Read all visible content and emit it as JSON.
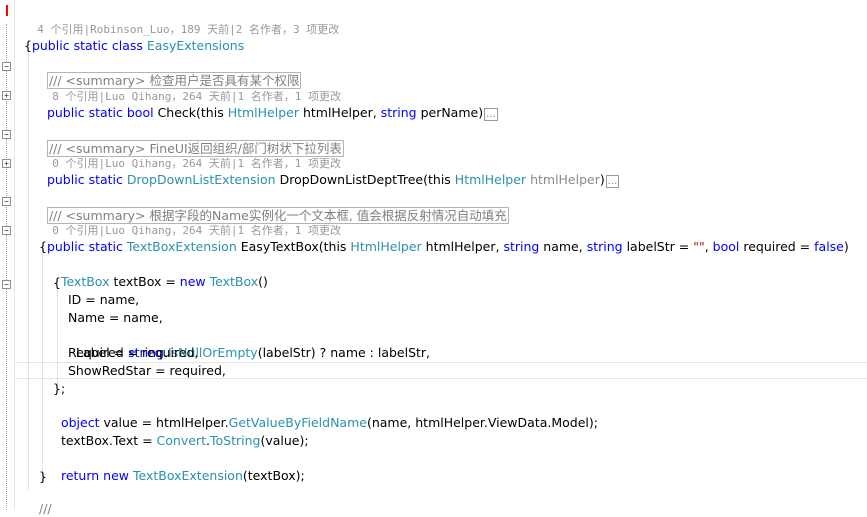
{
  "class_lens": {
    "refs": "4 个引用",
    "sep": "|",
    "author": "Robinson_Luo",
    "age": "，189 天前",
    "authors": "|2 名作者",
    "changes": "，3 项更改"
  },
  "class_decl": {
    "k1": "public",
    "k2": "static",
    "k3": "class",
    "name": "EasyExtensions"
  },
  "brace_open": "{",
  "m1": {
    "summary_prefix": "/// <summary>",
    "summary_text": " 检查用户是否具有某个权限",
    "lens": {
      "refs": "8 个引用",
      "sep": "|",
      "author": "Luo Qihang",
      "age": "，264 天前",
      "authors": "|1 名作者",
      "changes": "，1 项更改"
    },
    "k1": "public",
    "k2": "static",
    "k3": "bool",
    "name": "Check",
    "p1": "(this ",
    "t1": "HtmlHelper",
    "p2": " htmlHelper, ",
    "k4": "string",
    "p3": " perName)",
    "collapsed": "..."
  },
  "m2": {
    "summary_prefix": "/// <summary>",
    "summary_text": " FineUI返回组织/部门树状下拉列表",
    "lens": {
      "refs": "0 个引用",
      "sep": "|",
      "author": "Luo Qihang",
      "age": "，264 天前",
      "authors": "|1 名作者",
      "changes": "，1 项更改"
    },
    "k1": "public",
    "k2": "static",
    "rtype": "DropDownListExtension",
    "name": "DropDownListDeptTree",
    "p1": "(this ",
    "t1": "HtmlHelper",
    "p2": " ",
    "p3": "htmlHelper",
    ")": ")",
    "collapsed": "..."
  },
  "m3": {
    "summary_prefix": "/// <summary>",
    "summary_text": " 根据字段的Name实例化一个文本框, 值会根据反射情况自动填充",
    "lens": {
      "refs": "0 个引用",
      "sep": "|",
      "author": "Luo Qihang",
      "age": "，264 天前",
      "authors": "|1 名作者",
      "changes": "，1 项更改"
    },
    "k1": "public",
    "k2": "static",
    "rtype": "TextBoxExtension",
    "name": "EasyTextBox",
    "p1": "(this ",
    "t1": "HtmlHelper",
    "p2": " htmlHelper, ",
    "k3": "string",
    "p3": " name, ",
    "k4": "string",
    "p4": " labelStr = ",
    "s1": "\"\"",
    "p5": ", ",
    "k5": "bool",
    "p6": " required = ",
    "k6": "false",
    "p7": ")"
  },
  "body": {
    "open": "{",
    "l1": {
      "t1": "TextBox",
      "p1": " textBox = ",
      "k1": "new",
      "p2": " ",
      "t2": "TextBox",
      "p3": "()"
    },
    "init_open": "{",
    "l2": "ID = name,",
    "l3": "Name = name,",
    "l4": {
      "p1": "Label = ",
      "k1": "string",
      "p2": ".",
      "m": "IsNullOrEmpty",
      "p3": "(labelStr) ? name : labelStr,"
    },
    "l5": "Required = required,",
    "l6": "ShowRedStar = required,",
    "init_close": "};",
    "l7": {
      "k1": "object",
      "p1": " value = htmlHelper.",
      "m": "GetValueByFieldName",
      "p2": "(name, htmlHelper.ViewData.Model);"
    },
    "l8": {
      "p1": "textBox.Text = ",
      "t1": "Convert",
      "p2": ".",
      "m": "ToString",
      "p3": "(value);"
    },
    "l9": {
      "k1": "return",
      "p1": " ",
      "k2": "new",
      "p2": " ",
      "t1": "TextBoxExtension",
      "p3": "(textBox);"
    },
    "close": "}"
  },
  "trailing": "///",
  "colors": {
    "keyword": "#0000ff",
    "type": "#2b91af",
    "comment": "#808080",
    "string": "#a31515",
    "lens": "#999999"
  }
}
